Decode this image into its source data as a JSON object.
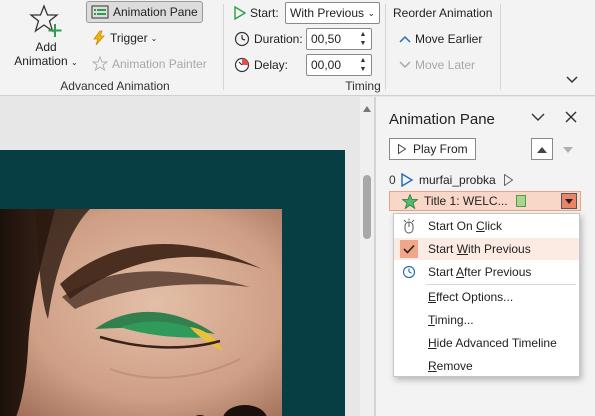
{
  "ribbon": {
    "add_animation": {
      "line1": "Add",
      "line2": "Animation"
    },
    "animation_pane": "Animation Pane",
    "trigger": "Trigger",
    "animation_painter": "Animation Painter",
    "advanced_group": "Advanced Animation",
    "start_label": "Start:",
    "start_value": "With Previous",
    "duration_label": "Duration:",
    "duration_value": "00,50",
    "delay_label": "Delay:",
    "delay_value": "00,00",
    "timing_group": "Timing",
    "reorder_label": "Reorder Animation",
    "move_earlier": "Move Earlier",
    "move_later": "Move Later"
  },
  "pane": {
    "title": "Animation Pane",
    "play_from": "Play From",
    "items": [
      {
        "num": "0",
        "label": "murfai_probka"
      },
      {
        "num": "",
        "label": "Title 1: WELC..."
      }
    ]
  },
  "menu": {
    "items": [
      {
        "pre": "Start On ",
        "key": "C",
        "post": "lick",
        "icon": "mouse-click-icon",
        "checked": false
      },
      {
        "pre": "Start ",
        "key": "W",
        "post": "ith Previous",
        "icon": "checkmark-icon",
        "checked": true
      },
      {
        "pre": "Start ",
        "key": "A",
        "post": "fter Previous",
        "icon": "clock-icon",
        "checked": false
      },
      {
        "pre": "",
        "key": "E",
        "post": "ffect Options...",
        "icon": "",
        "checked": false
      },
      {
        "pre": "",
        "key": "T",
        "post": "iming...",
        "icon": "",
        "checked": false
      },
      {
        "pre": "",
        "key": "H",
        "post": "ide Advanced Timeline",
        "icon": "",
        "checked": false
      },
      {
        "pre": "",
        "key": "R",
        "post": "emove",
        "icon": "",
        "checked": false
      }
    ]
  },
  "colors": {
    "accent_green": "#2e9e4e",
    "slide_bg": "#073e43",
    "selected_item_bg": "#f8d6c8",
    "menu_check_bg": "#f1a689"
  }
}
